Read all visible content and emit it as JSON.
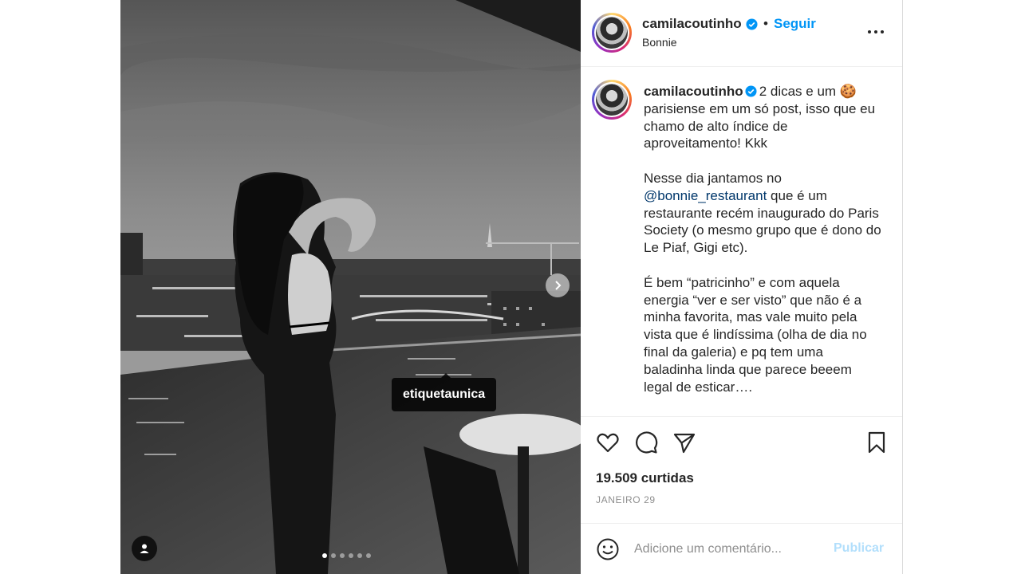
{
  "post": {
    "username": "camilacoutinho",
    "follow_label": "Seguir",
    "separator": "•",
    "location": "Bonnie"
  },
  "photo": {
    "tag_label": "etiquetaunica",
    "slide_count": 6,
    "active_slide": 0
  },
  "caption": {
    "username": "camilacoutinho",
    "p1": "2 dicas e um 🍪 parisiense em um só post, isso que eu chamo de alto índice de aproveitamento! Kkk",
    "p2_before": "Nesse dia jantamos no ",
    "p2_mention": "@bonnie_restaurant",
    "p2_after": " que é um restaurante recém inaugurado do Paris Society (o mesmo grupo que é dono do Le Piaf, Gigi etc).",
    "p3": "É bem “patricinho” e com aquela energia “ver e ser visto” que não é a minha favorita, mas vale muito pela vista que é lindíssima (olha de dia no final da galeria) e pq tem uma baladinha linda que parece beeem legal de esticar…."
  },
  "stats": {
    "likes": "19.509 curtidas",
    "date": "JANEIRO 29"
  },
  "comment": {
    "placeholder": "Adicione um comentário...",
    "publish_label": "Publicar"
  },
  "icons": {
    "verified": "verified-badge-icon",
    "more": "more-options-icon",
    "like": "heart-icon",
    "comment": "comment-bubble-icon",
    "share": "paper-plane-icon",
    "save": "bookmark-icon",
    "emoji": "emoji-smile-icon",
    "user_tag": "user-tag-icon",
    "next": "chevron-right-icon"
  },
  "colors": {
    "accent": "#0095f6",
    "mention": "#00376b",
    "muted": "#8e8e8e",
    "publish_disabled": "#b2dffc",
    "text": "#262626"
  }
}
